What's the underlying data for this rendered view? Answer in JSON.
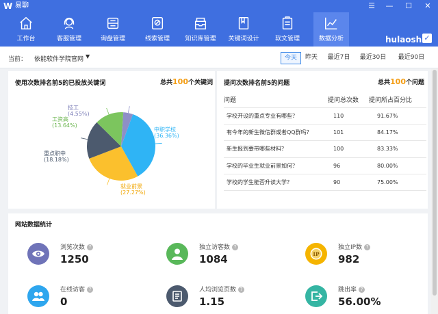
{
  "app": {
    "name": "易聊",
    "logo_char": "W"
  },
  "nav": {
    "items": [
      {
        "label": "工作台",
        "icon": "home-icon"
      },
      {
        "label": "客服管理",
        "icon": "customer-service-icon"
      },
      {
        "label": "询盘管理",
        "icon": "inquiry-icon"
      },
      {
        "label": "线索管理",
        "icon": "clue-icon"
      },
      {
        "label": "知识库管理",
        "icon": "knowledge-icon"
      },
      {
        "label": "关键词设计",
        "icon": "keyword-icon"
      },
      {
        "label": "软文管理",
        "icon": "article-icon"
      },
      {
        "label": "数据分析",
        "icon": "analytics-icon",
        "active": true
      }
    ],
    "user": "hulaoshi"
  },
  "filter": {
    "current_label": "当前：",
    "site": "依能软件学院官网",
    "dropdown_arrow": "▼",
    "dates": [
      "今天",
      "昨天",
      "最近7日",
      "最近30日",
      "最近90日"
    ],
    "active_date": "今天"
  },
  "keywords_panel": {
    "title": "使用次数排名前5的已投放关键词",
    "total_prefix": "总共",
    "total_num": "100",
    "total_suffix": "个关键词"
  },
  "chart_data": {
    "type": "pie",
    "slices": [
      {
        "name": "中职学校",
        "pct": "(36.36%)",
        "value": 36.36,
        "color": "#2fb4f5"
      },
      {
        "name": "就业前景",
        "pct": "(27.27%)",
        "value": 27.27,
        "color": "#fbc02d"
      },
      {
        "name": "重点职中",
        "pct": "(18.18%)",
        "value": 18.18,
        "color": "#4c5a6e"
      },
      {
        "name": "工资高",
        "pct": "(13.64%)",
        "value": 13.64,
        "color": "#7cc55e"
      },
      {
        "name": "技工",
        "pct": "(4.55%)",
        "value": 4.55,
        "color": "#8e8fc7"
      }
    ]
  },
  "questions_panel": {
    "title": "提问次数排名前5的问题",
    "total_prefix": "总共",
    "total_num": "100",
    "total_suffix": "个问题",
    "headers": [
      "问题",
      "提问总次数",
      "提问所占百分比"
    ],
    "rows": [
      {
        "q": "学校开设的重点专业有哪些？",
        "count": "110",
        "pct": "91.67%"
      },
      {
        "q": "有今年的新生微信群或者QQ群吗？",
        "count": "101",
        "pct": "84.17%"
      },
      {
        "q": "新生报到要带哪些材料？",
        "count": "100",
        "pct": "83.33%"
      },
      {
        "q": "学校的毕业生就业前景如何？",
        "count": "96",
        "pct": "80.00%"
      },
      {
        "q": "学校的学生能否升读大学？",
        "count": "90",
        "pct": "75.00%"
      }
    ]
  },
  "stats_panel": {
    "title": "网站数据统计",
    "help_char": "?",
    "items": [
      {
        "label": "浏览次数",
        "value": "1250",
        "color": "#6f73b8",
        "icon": "eye-icon"
      },
      {
        "label": "独立访客数",
        "value": "1084",
        "color": "#59b85a",
        "icon": "user-icon"
      },
      {
        "label": "独立IP数",
        "value": "982",
        "color": "#f5b400",
        "icon": "ip-icon"
      },
      {
        "label": "在线访客",
        "value": "0",
        "color": "#2ea6ee",
        "icon": "users-icon"
      },
      {
        "label": "人均浏览页数",
        "value": "1.15",
        "color": "#4c5a6e",
        "icon": "document-icon"
      },
      {
        "label": "跳出率",
        "value": "56.00%",
        "color": "#35b5a3",
        "icon": "exit-icon"
      }
    ]
  }
}
